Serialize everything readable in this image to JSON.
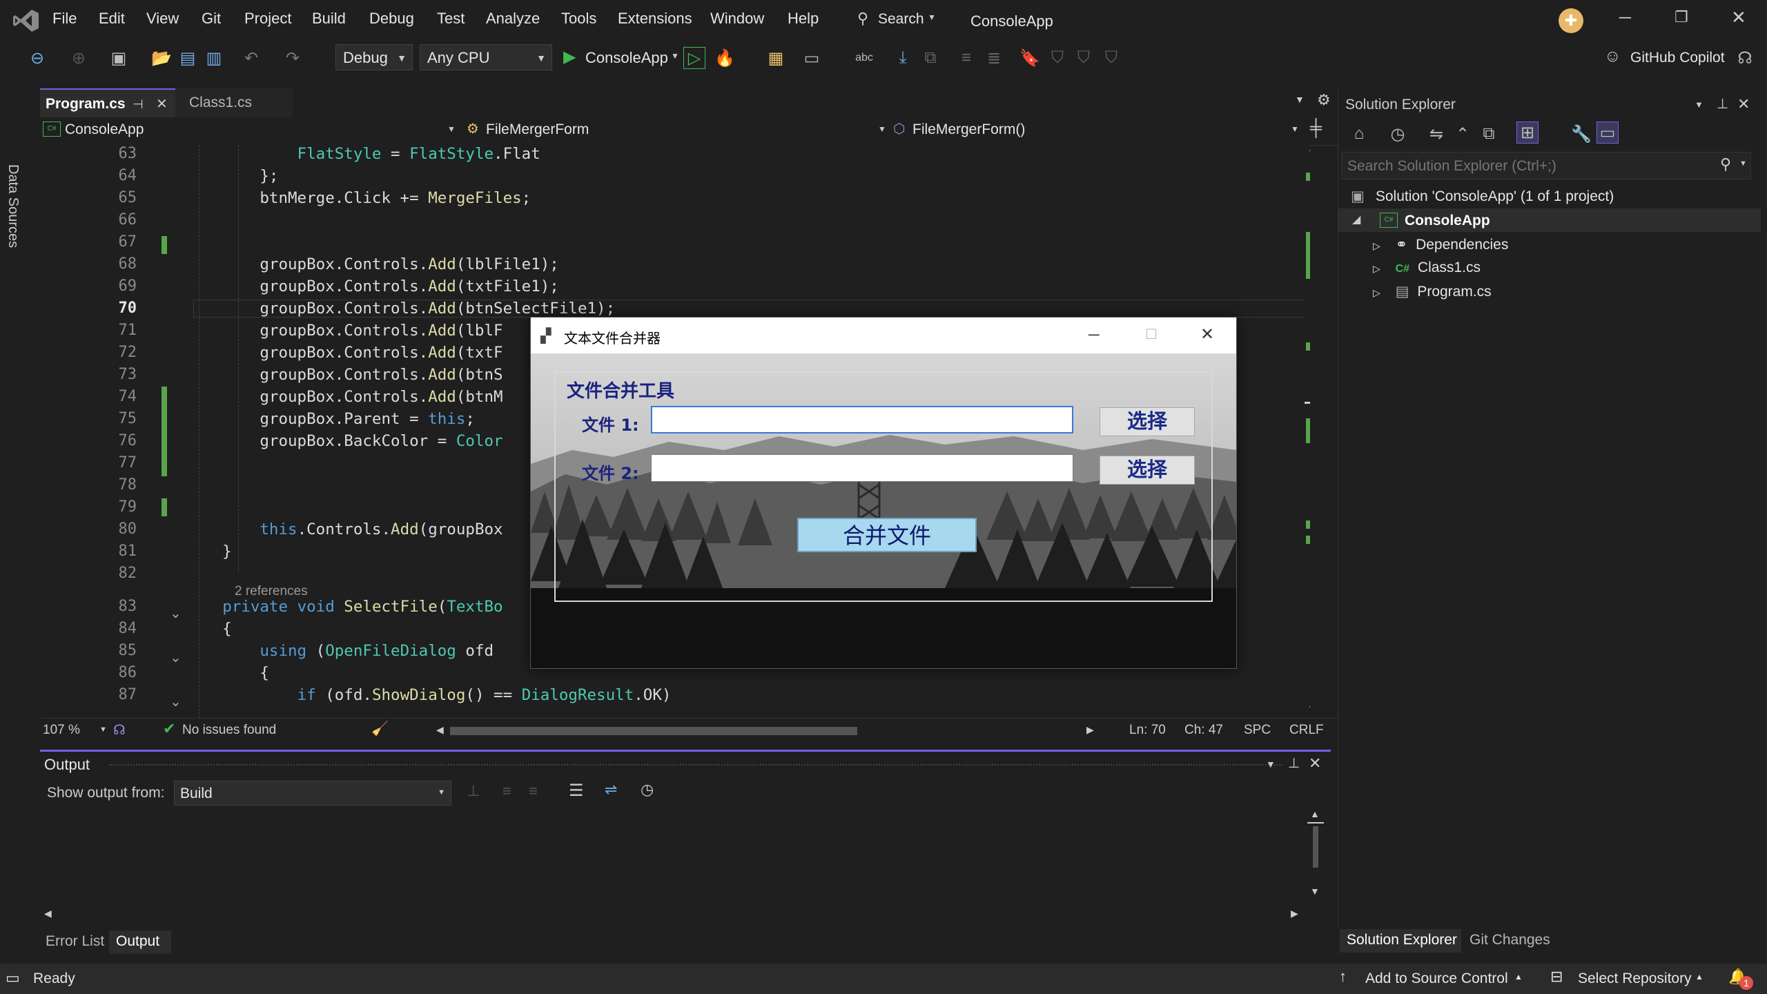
{
  "menu": [
    "File",
    "Edit",
    "View",
    "Git",
    "Project",
    "Build",
    "Debug",
    "Test",
    "Analyze",
    "Tools",
    "Extensions",
    "Window",
    "Help"
  ],
  "search_label": "Search",
  "app_title": "ConsoleApp",
  "toolbar": {
    "config": "Debug",
    "platform": "Any CPU",
    "run_target": "ConsoleApp",
    "copilot": "GitHub Copilot"
  },
  "side_strip_label": "Data Sources",
  "tabs": [
    {
      "label": "Program.cs",
      "active": true
    },
    {
      "label": "Class1.cs",
      "active": false
    }
  ],
  "navbar": {
    "project": "ConsoleApp",
    "type": "FileMergerForm",
    "member": "FileMergerForm()"
  },
  "code_lines": [
    {
      "n": "63",
      "text": "            FlatStyle = FlatStyle.Flat"
    },
    {
      "n": "64",
      "text": "        };"
    },
    {
      "n": "65",
      "text": "        btnMerge.Click += MergeFiles;"
    },
    {
      "n": "66",
      "text": ""
    },
    {
      "n": "67",
      "text": ""
    },
    {
      "n": "68",
      "text": "        groupBox.Controls.Add(lblFile1);"
    },
    {
      "n": "69",
      "text": "        groupBox.Controls.Add(txtFile1);"
    },
    {
      "n": "70",
      "text": "        groupBox.Controls.Add(btnSelectFile1);"
    },
    {
      "n": "71",
      "text": "        groupBox.Controls.Add(lblF"
    },
    {
      "n": "72",
      "text": "        groupBox.Controls.Add(txtF"
    },
    {
      "n": "73",
      "text": "        groupBox.Controls.Add(btnS"
    },
    {
      "n": "74",
      "text": "        groupBox.Controls.Add(btnM"
    },
    {
      "n": "75",
      "text": "        groupBox.Parent = this;"
    },
    {
      "n": "76",
      "text": "        groupBox.BackColor = Color"
    },
    {
      "n": "77",
      "text": ""
    },
    {
      "n": "78",
      "text": ""
    },
    {
      "n": "79",
      "text": ""
    },
    {
      "n": "80",
      "text": "        this.Controls.Add(groupBox"
    },
    {
      "n": "81",
      "text": "    }"
    },
    {
      "n": "82",
      "text": ""
    },
    {
      "n": "83",
      "text": "    private void SelectFile(TextBo"
    },
    {
      "n": "84",
      "text": "    {"
    },
    {
      "n": "85",
      "text": "        using (OpenFileDialog ofd"
    },
    {
      "n": "86",
      "text": "        {"
    },
    {
      "n": "87",
      "text": "            if (ofd.ShowDialog() == DialogResult.OK)"
    }
  ],
  "codelens": "2 references",
  "editor_status": {
    "zoom": "107 %",
    "issues": "No issues found",
    "ln": "Ln: 70",
    "ch": "Ch: 47",
    "spc": "SPC",
    "crlf": "CRLF"
  },
  "output": {
    "title": "Output",
    "show_from_label": "Show output from:",
    "source": "Build"
  },
  "bottom_tabs": [
    "Error List",
    "Output"
  ],
  "solution_explorer": {
    "title": "Solution Explorer",
    "search_placeholder": "Search Solution Explorer (Ctrl+;)",
    "solution": "Solution 'ConsoleApp' (1 of 1 project)",
    "project": "ConsoleApp",
    "items": [
      "Dependencies",
      "Class1.cs",
      "Program.cs"
    ],
    "tabs": [
      "Solution Explorer",
      "Git Changes"
    ]
  },
  "dialog": {
    "title": "文本文件合并器",
    "heading": "文件合并工具",
    "file1_label": "文件 1:",
    "file2_label": "文件 2:",
    "select1": "选择",
    "select2": "选择",
    "merge": "合并文件"
  },
  "statusbar": {
    "ready": "Ready",
    "source_control": "Add to Source Control",
    "repository": "Select Repository",
    "notifications": "1"
  },
  "colors": {
    "accent": "#7160e8",
    "keyword": "#569cd6",
    "type": "#4ec9b0",
    "method": "#dcdcaa",
    "git_added": "#57a64a"
  }
}
